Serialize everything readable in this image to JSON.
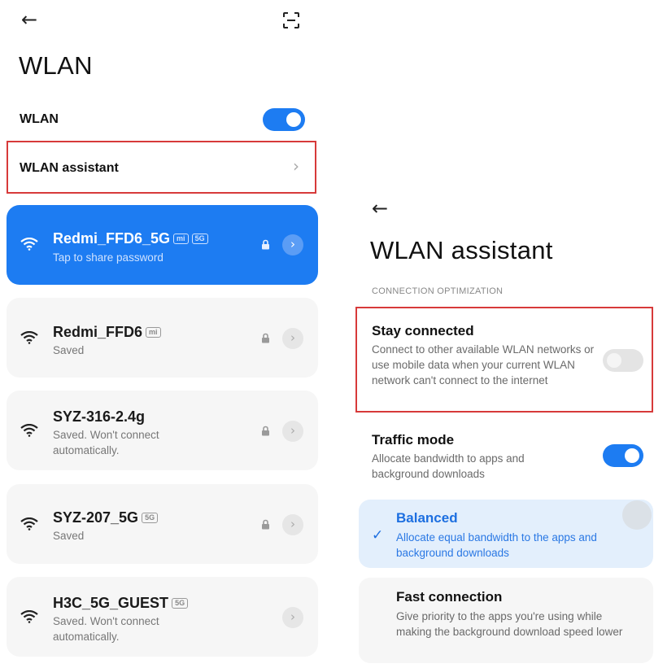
{
  "left": {
    "back_icon": "back-arrow-icon",
    "scan_icon": "scan-qr-icon",
    "title": "WLAN",
    "wlan_label": "WLAN",
    "wlan_toggle_on": true,
    "assistant_label": "WLAN assistant",
    "networks": [
      {
        "name": "Redmi_FFD6_5G",
        "badges": [
          "mi",
          "5G"
        ],
        "sub": "Tap to share password",
        "locked": true,
        "active": true
      },
      {
        "name": "Redmi_FFD6",
        "badges": [
          "mi"
        ],
        "sub": "Saved",
        "locked": true,
        "active": false
      },
      {
        "name": "SYZ-316-2.4g",
        "badges": [],
        "sub": "Saved. Won't connect automatically.",
        "locked": true,
        "active": false
      },
      {
        "name": "SYZ-207_5G",
        "badges": [
          "5G"
        ],
        "sub": "Saved",
        "locked": true,
        "active": false
      },
      {
        "name": "H3C_5G_GUEST",
        "badges": [
          "5G"
        ],
        "sub": "Saved. Won't connect automatically.",
        "locked": false,
        "active": false
      }
    ]
  },
  "right": {
    "back_icon": "back-arrow-icon",
    "title": "WLAN assistant",
    "section_header": "CONNECTION OPTIMIZATION",
    "stay_connected": {
      "title": "Stay connected",
      "desc": "Connect to other available WLAN networks or use mobile data when your current WLAN network can't connect to the internet",
      "toggle_on": false
    },
    "traffic_mode": {
      "title": "Traffic mode",
      "desc": "Allocate bandwidth to apps and background downloads",
      "toggle_on": true
    },
    "modes": [
      {
        "title": "Balanced",
        "desc": "Allocate equal bandwidth to the apps and background downloads",
        "selected": true
      },
      {
        "title": "Fast connection",
        "desc": "Give priority to the apps you're using while making the background download speed lower",
        "selected": false
      }
    ]
  },
  "colors": {
    "accent": "#1d7cf2",
    "highlight_box": "#d73a3a",
    "selected_card": "#e3effc"
  }
}
